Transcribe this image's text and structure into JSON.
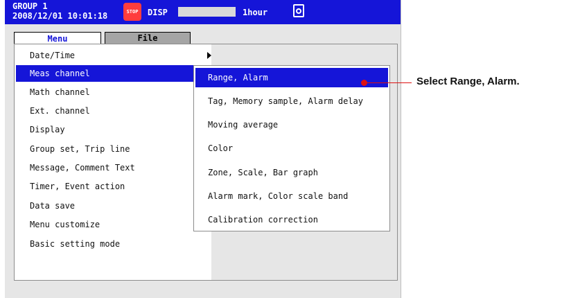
{
  "status": {
    "group": "GROUP 1",
    "datetime": "2008/12/01 10:01:18",
    "stop_icon_text": "STOP",
    "disp": "DISP",
    "timescale": "1hour",
    "icons": [
      "stop-icon",
      "camera-icon"
    ]
  },
  "tabs": [
    {
      "label": "Menu",
      "active": true
    },
    {
      "label": "File",
      "active": false
    }
  ],
  "menu": {
    "items": [
      {
        "label": "Date/Time",
        "has_submenu": true
      },
      {
        "label": "Meas channel",
        "selected": true
      },
      {
        "label": "Math channel"
      },
      {
        "label": "Ext. channel"
      },
      {
        "label": "Display"
      },
      {
        "label": "Group set, Trip line"
      },
      {
        "label": "Message, Comment Text"
      },
      {
        "label": "Timer, Event action"
      },
      {
        "label": "Data save"
      },
      {
        "label": "Menu customize"
      },
      {
        "label": "Basic setting mode"
      }
    ]
  },
  "submenu": {
    "items": [
      {
        "label": "Range, Alarm",
        "selected": true
      },
      {
        "label": "Tag, Memory sample, Alarm delay"
      },
      {
        "label": "Moving average"
      },
      {
        "label": "Color"
      },
      {
        "label": "Zone, Scale, Bar graph"
      },
      {
        "label": "Alarm mark, Color scale band"
      },
      {
        "label": "Calibration correction"
      }
    ]
  },
  "callout": {
    "text": "Select Range, Alarm."
  },
  "colors": {
    "accent": "#1515d8",
    "callout": "#dd1111",
    "panel": "#e6e6e6"
  }
}
